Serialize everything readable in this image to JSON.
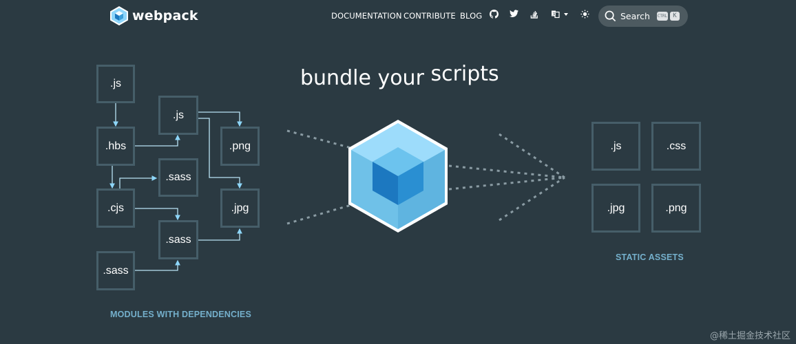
{
  "header": {
    "brand": "webpack",
    "nav": {
      "documentation": "DOCUMENTATION",
      "contribute": "CONTRIBUTE",
      "blog": "BLOG"
    },
    "icons": [
      "github-icon",
      "twitter-icon",
      "stack-overflow-icon",
      "language-icon",
      "theme-toggle-icon"
    ],
    "search": {
      "label": "Search",
      "shortcut_ctrl": "CTRL",
      "shortcut_key": "K"
    }
  },
  "hero": {
    "headline_word1": "bundle your",
    "headline_word2": "scripts",
    "modules_caption": "MODULES WITH DEPENDENCIES",
    "assets_caption": "STATIC ASSETS",
    "modules": {
      "js_top": ".js",
      "hbs": ".hbs",
      "cjs": ".cjs",
      "sass_bottom": ".sass",
      "js_mid": ".js",
      "sass_upper": ".sass",
      "sass_lower": ".sass",
      "png": ".png",
      "jpg": ".jpg"
    },
    "assets": {
      "js": ".js",
      "css": ".css",
      "jpg": ".jpg",
      "png": ".png"
    }
  },
  "colors": {
    "background": "#2b3a42",
    "box_border": "#465e69",
    "accent": "#8dd6f9",
    "cube_light": "#8ed6fb",
    "cube_dark": "#1c78c0"
  },
  "watermark": "@稀土掘金技术社区"
}
